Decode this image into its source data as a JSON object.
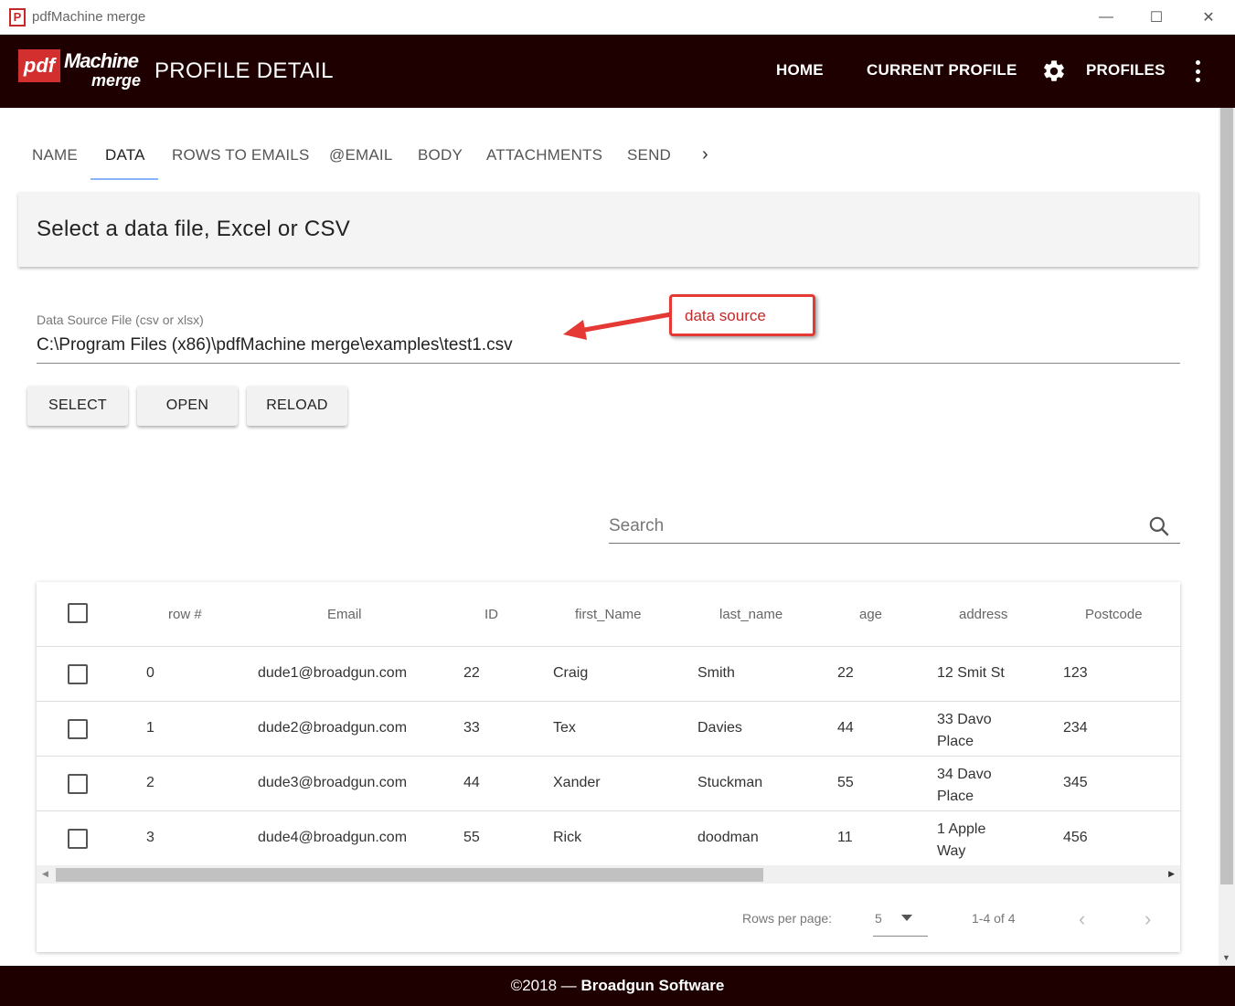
{
  "window": {
    "title": "pdfMachine merge",
    "app_icon_letter": "P",
    "minimize": "—",
    "maximize": "☐",
    "close": "✕"
  },
  "appbar": {
    "logo_pdf": "pdf",
    "logo_machine": "Machine",
    "logo_merge": "merge",
    "title": "PROFILE DETAIL",
    "nav": {
      "home": "HOME",
      "current_profile": "CURRENT PROFILE",
      "profiles": "PROFILES"
    }
  },
  "tabs": {
    "items": [
      "NAME",
      "DATA",
      "ROWS TO EMAILS",
      "@EMAIL",
      "BODY",
      "ATTACHMENTS",
      "SEND"
    ],
    "active": "DATA",
    "next": "›"
  },
  "section": {
    "title": "Select a data file, Excel or CSV"
  },
  "data_source": {
    "label": "Data Source File (csv or xlsx)",
    "value": "C:\\Program Files (x86)\\pdfMachine merge\\examples\\test1.csv"
  },
  "annotation": {
    "text": "data source",
    "color": "#e53935"
  },
  "buttons": {
    "select": "SELECT",
    "open": "OPEN",
    "reload": "RELOAD"
  },
  "search": {
    "placeholder": "Search"
  },
  "table": {
    "headers": [
      "row #",
      "Email",
      "ID",
      "first_Name",
      "last_name",
      "age",
      "address",
      "Postcode"
    ],
    "rows": [
      {
        "row": "0",
        "email": "dude1@broadgun.com",
        "id": "22",
        "first": "Craig",
        "last": "Smith",
        "age": "22",
        "address_1": "12 Smit St",
        "address_2": "",
        "postcode": "123"
      },
      {
        "row": "1",
        "email": "dude2@broadgun.com",
        "id": "33",
        "first": "Tex",
        "last": "Davies",
        "age": "44",
        "address_1": "33 Davo",
        "address_2": "Place",
        "postcode": "234"
      },
      {
        "row": "2",
        "email": "dude3@broadgun.com",
        "id": "44",
        "first": "Xander",
        "last": "Stuckman",
        "age": "55",
        "address_1": "34 Davo",
        "address_2": "Place",
        "postcode": "345"
      },
      {
        "row": "3",
        "email": "dude4@broadgun.com",
        "id": "55",
        "first": "Rick",
        "last": "doodman",
        "age": "11",
        "address_1": "1 Apple",
        "address_2": "Way",
        "postcode": "456"
      }
    ]
  },
  "pagination": {
    "rows_per_page_label": "Rows per page:",
    "rows_per_page_value": "5",
    "range": "1-4 of 4",
    "prev": "‹",
    "next": "›"
  },
  "footer": {
    "copyright": "©2018 — ",
    "company": "Broadgun Software"
  },
  "colors": {
    "appbar_bg": "#1e0000",
    "logo_red": "#d32f2f",
    "tab_underline": "#8ab4f8"
  }
}
